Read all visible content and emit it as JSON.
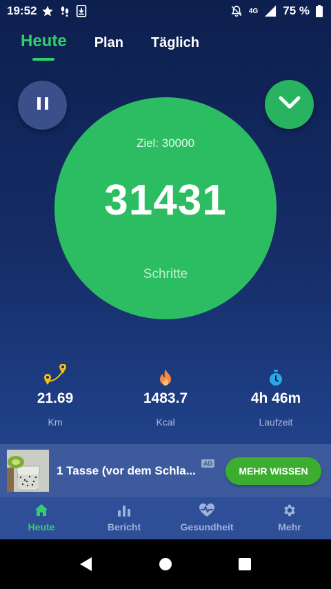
{
  "status_bar": {
    "time": "19:52",
    "network": "4G",
    "battery": "75 %"
  },
  "tabs": [
    {
      "label": "Heute",
      "active": true
    },
    {
      "label": "Plan",
      "active": false
    },
    {
      "label": "Täglich",
      "active": false
    }
  ],
  "steps": {
    "goal": "Ziel: 30000",
    "count": "31431",
    "label": "Schritte"
  },
  "stats": [
    {
      "icon": "map-route-icon",
      "value": "21.69",
      "unit": "Km"
    },
    {
      "icon": "flame-icon",
      "value": "1483.7",
      "unit": "Kcal"
    },
    {
      "icon": "stopwatch-icon",
      "value": "4h 46m",
      "unit": "Laufzeit"
    }
  ],
  "ad": {
    "title": "1 Tasse (vor dem Schla...",
    "badge": "AD",
    "cta": "MEHR WISSEN"
  },
  "bottom_nav": [
    {
      "label": "Heute",
      "icon": "home-icon",
      "active": true
    },
    {
      "label": "Bericht",
      "icon": "bar-chart-icon",
      "active": false
    },
    {
      "label": "Gesundheit",
      "icon": "heartbeat-icon",
      "active": false
    },
    {
      "label": "Mehr",
      "icon": "gear-icon",
      "active": false
    }
  ],
  "colors": {
    "accent_green": "#2fd06a",
    "circle_green": "#2cbd62",
    "background_top": "#0d1f4e",
    "background_bottom": "#24478f",
    "ad_cta": "#3cad2f"
  }
}
